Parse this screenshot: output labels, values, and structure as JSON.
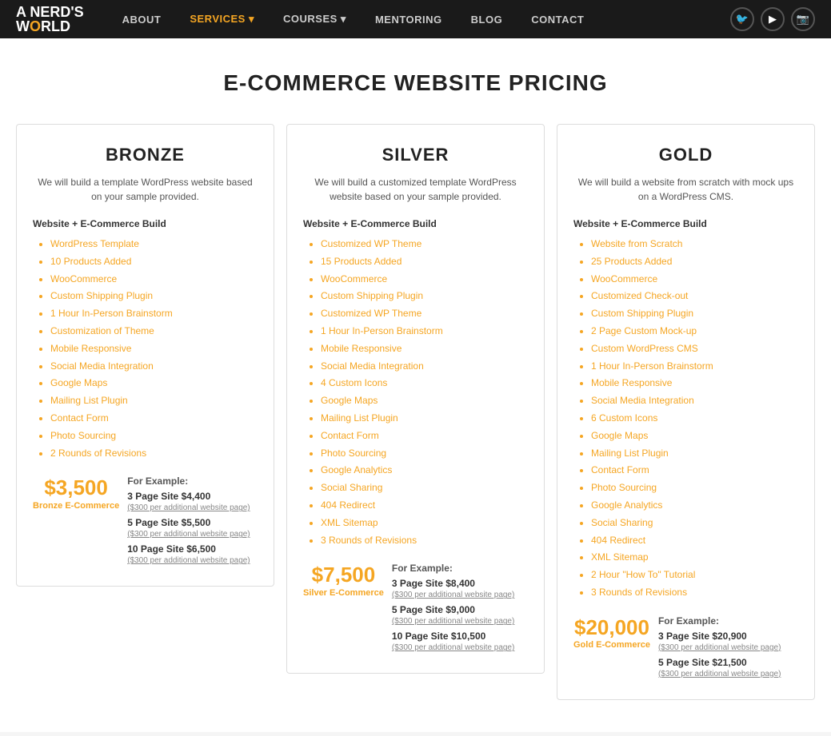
{
  "nav": {
    "logo_line1": "A NERD'S",
    "logo_line2": "WORLD",
    "links": [
      {
        "label": "ABOUT",
        "active": false
      },
      {
        "label": "SERVICES",
        "active": true,
        "has_dropdown": true
      },
      {
        "label": "COURSES",
        "active": false,
        "has_dropdown": true
      },
      {
        "label": "MENTORING",
        "active": false
      },
      {
        "label": "BLOG",
        "active": false
      },
      {
        "label": "CONTACT",
        "active": false
      }
    ],
    "icons": [
      "twitter",
      "youtube",
      "instagram"
    ]
  },
  "page": {
    "title": "E-COMMERCE WEBSITE PRICING"
  },
  "plans": [
    {
      "id": "bronze",
      "title": "BRONZE",
      "description": "We will build a template WordPress website based on your sample provided.",
      "section_label": "Website + E-Commerce Build",
      "features": [
        "WordPress Template",
        "10 Products Added",
        "WooCommerce",
        "Custom Shipping Plugin",
        "1 Hour In-Person Brainstorm",
        "Customization of Theme",
        "Mobile Responsive",
        "Social Media Integration",
        "Google Maps",
        "Mailing List Plugin",
        "Contact Form",
        "Photo Sourcing",
        "2 Rounds of Revisions"
      ],
      "price": "$3,500",
      "price_label": "Bronze E-Commerce",
      "example_title": "For Example:",
      "examples": [
        {
          "label": "3 Page Site $4,400",
          "note": "($300 per additional website page)"
        },
        {
          "label": "5 Page Site $5,500",
          "note": "($300 per additional website page)"
        },
        {
          "label": "10 Page Site $6,500",
          "note": "($300 per additional website page)"
        }
      ]
    },
    {
      "id": "silver",
      "title": "SILVER",
      "description": "We will build a customized template WordPress website based on your sample provided.",
      "section_label": "Website + E-Commerce Build",
      "features": [
        "Customized WP Theme",
        "15 Products Added",
        "WooCommerce",
        "Custom Shipping Plugin",
        "Customized WP Theme",
        "1 Hour In-Person Brainstorm",
        "Mobile Responsive",
        "Social Media Integration",
        "4 Custom Icons",
        "Google Maps",
        "Mailing List Plugin",
        "Contact Form",
        "Photo Sourcing",
        "Google Analytics",
        "Social Sharing",
        "404 Redirect",
        "XML Sitemap",
        "3 Rounds of Revisions"
      ],
      "price": "$7,500",
      "price_label": "Silver E-Commerce",
      "example_title": "For Example:",
      "examples": [
        {
          "label": "3 Page Site $8,400",
          "note": "($300 per additional website page)"
        },
        {
          "label": "5 Page Site $9,000",
          "note": "($300 per additional website page)"
        },
        {
          "label": "10 Page Site $10,500",
          "note": "($300 per additional website page)"
        }
      ]
    },
    {
      "id": "gold",
      "title": "GOLD",
      "description": "We will build a website from scratch with mock ups on a WordPress CMS.",
      "section_label": "Website + E-Commerce Build",
      "features": [
        "Website from Scratch",
        "25 Products Added",
        "WooCommerce",
        "Customized Check-out",
        "Custom Shipping Plugin",
        "2 Page Custom Mock-up",
        "Custom WordPress CMS",
        "1 Hour In-Person Brainstorm",
        "Mobile Responsive",
        "Social Media Integration",
        "6 Custom Icons",
        "Google Maps",
        "Mailing List Plugin",
        "Contact Form",
        "Photo Sourcing",
        "Google Analytics",
        "Social Sharing",
        "404 Redirect",
        "XML Sitemap",
        "2 Hour \"How To\" Tutorial",
        "3 Rounds of Revisions"
      ],
      "price": "$20,000",
      "price_label": "Gold E-Commerce",
      "example_title": "For Example:",
      "examples": [
        {
          "label": "3 Page Site $20,900",
          "note": "($300 per additional website page)"
        },
        {
          "label": "5 Page Site $21,500",
          "note": "($300 per additional website page)"
        }
      ]
    }
  ]
}
